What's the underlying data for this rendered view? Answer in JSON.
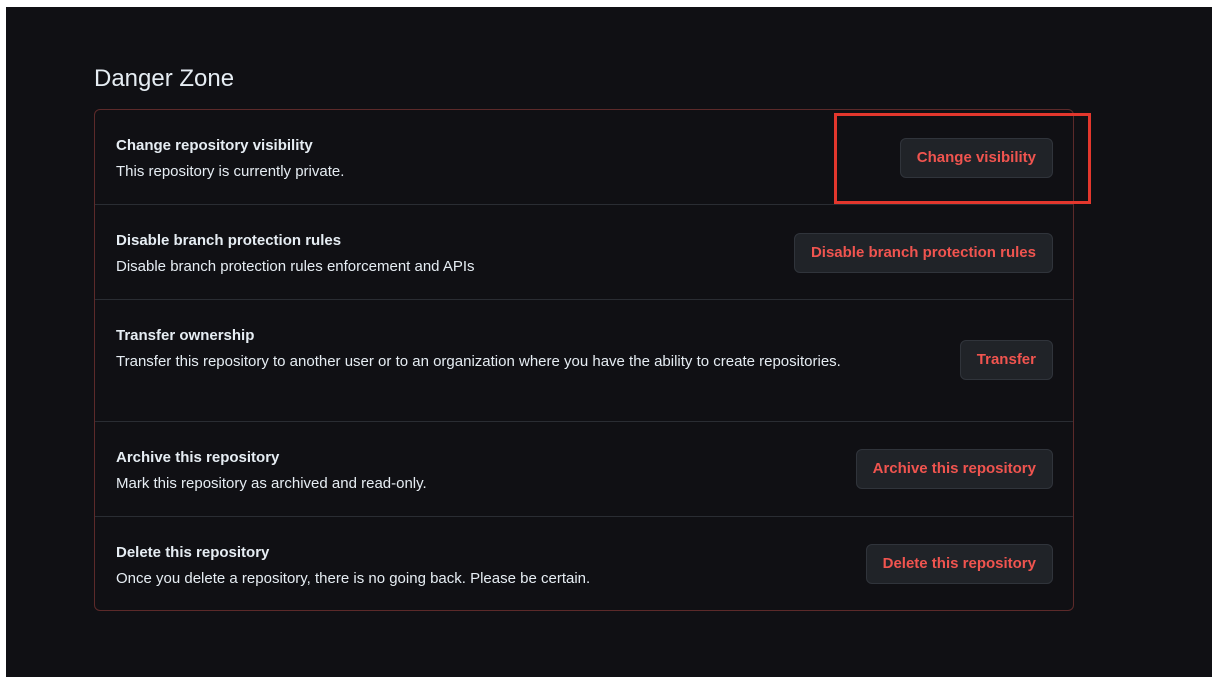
{
  "section": {
    "title": "Danger Zone"
  },
  "rows": [
    {
      "title": "Change repository visibility",
      "description": "This repository is currently private.",
      "button": "Change visibility"
    },
    {
      "title": "Disable branch protection rules",
      "description": "Disable branch protection rules enforcement and APIs",
      "button": "Disable branch protection rules"
    },
    {
      "title": "Transfer ownership",
      "description": "Transfer this repository to another user or to an organization where you have the ability to create repositories.",
      "button": "Transfer"
    },
    {
      "title": "Archive this repository",
      "description": "Mark this repository as archived and read-only.",
      "button": "Archive this repository"
    },
    {
      "title": "Delete this repository",
      "description": "Once you delete a repository, there is no going back. Please be certain.",
      "button": "Delete this repository"
    }
  ],
  "colors": {
    "background": "#101014",
    "danger_text": "#f0544f",
    "danger_border": "#5c2a2a",
    "highlight": "#e3372d"
  }
}
